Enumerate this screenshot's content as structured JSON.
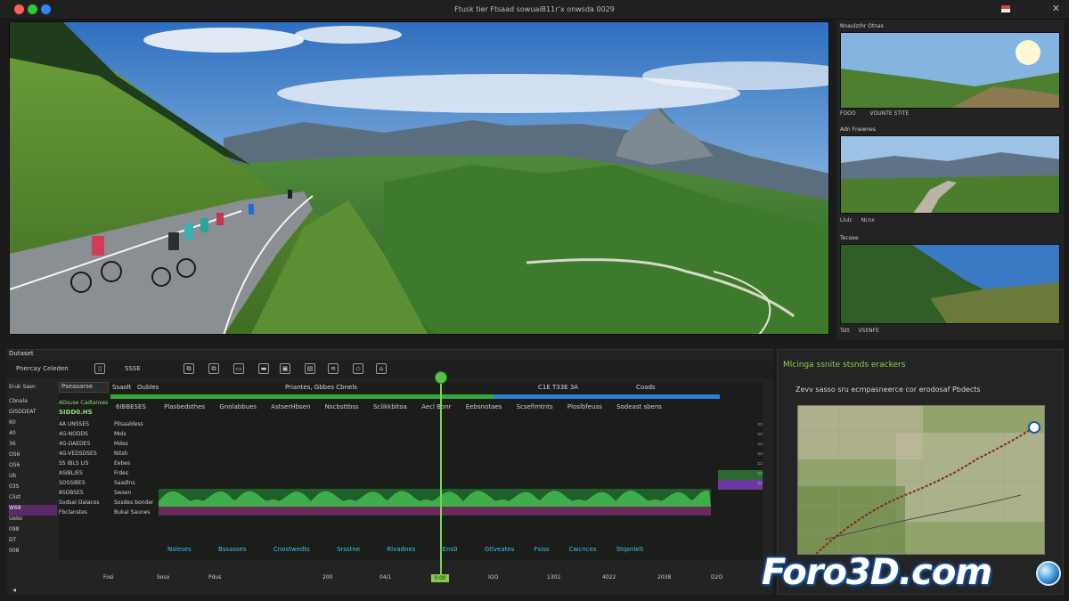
{
  "window": {
    "title": "Ftusk tier Ftsaad sowuaiB11r’x onwsda 0029"
  },
  "colors": {
    "accent_green": "#58c248",
    "clip_purple": "#7a2c7a",
    "waveform_green": "#2f8f3a",
    "header_blue": "#2f7fd6",
    "title_green": "#8fd04a"
  },
  "thumbnails": [
    {
      "header": "Nnaulzrhr Otnas",
      "footer_left": "FOOO",
      "footer_right": "VOUNTE STITE"
    },
    {
      "header": "Adn Fnewnes",
      "footer_left": "Llulc",
      "footer_right": "Ncnx"
    },
    {
      "header": "Tecoee",
      "footer_left": "Tstt",
      "footer_right": "VSENFE"
    }
  ],
  "timeline": {
    "panel_title": "Dutaset",
    "toolbar": {
      "project_label": "Pnercay Celeden",
      "tool_label": "SSSE",
      "project_icon": "page-icon"
    },
    "track_panel_title": "Eruk Sasn",
    "track_header": "Pseasarse",
    "column_headers": {
      "left": "Ssaolt",
      "left2": "Oubles",
      "center": "Priantes, Gbbes Cbnels",
      "right": "C1E T33E 3A",
      "far_right": "Coads"
    },
    "track_names": [
      "Cbnala",
      "GISDDEAT",
      "60",
      "40",
      "36",
      "OS6",
      "OS6",
      "Ub",
      "03S",
      "Clist",
      "W68",
      "Ueko",
      "098",
      "DT",
      "008"
    ],
    "track_rows": [
      {
        "a": "ADsuse Cadlanses",
        "b": "SIDD0.HS"
      },
      {
        "a": "4A UNSSES",
        "b": "Pilsaaldess"
      },
      {
        "a": "4G-NODDS",
        "b": "Mols"
      },
      {
        "a": "4G-DAEDES",
        "b": "Mdes"
      },
      {
        "a": "4G-VEDSDSES",
        "b": "Nitsh"
      },
      {
        "a": "SS IBLS LIS",
        "b": "Eebes"
      },
      {
        "a": "ASIBL/ES",
        "b": "Frdes"
      },
      {
        "a": "SOSSIBES",
        "b": "Saadlns"
      },
      {
        "a": "8SDBSES",
        "b": "Swsen"
      },
      {
        "a": "Sodsal Oalacos",
        "b": "Sosdes bonder"
      },
      {
        "a": "Fbclanstes",
        "b": "Bukal Saunes"
      }
    ],
    "clip_labels": [
      "6IBBESES",
      "Plasbedsthes",
      "Gnolabbues",
      "AstserHbsen",
      "Nscbsttbss",
      "Sclikkbitoa",
      "Aecl Bonr",
      "Eebsnotaes",
      "Scsefimtnts",
      "Ploslbfeuss",
      "Sodeast sbens"
    ],
    "bottom_labels": [
      "Nsleses",
      "Bssasses",
      "Cnostwedts",
      "Srsstne",
      "Rlvadnes",
      "Ens0",
      "Gtlveates",
      "Fsiss",
      "Cwcnces",
      "Stqsnlelt"
    ],
    "ruler": [
      "Fosi",
      "Soso",
      "Pdus",
      "200",
      "04/1",
      "IOO",
      "1302",
      "4022",
      "2038",
      "D2O"
    ],
    "playhead_time": "0:00"
  },
  "right_panel": {
    "title": "Mlcinga ssnite stsnds erackers",
    "description": "Zevv sasso sru ecmpasneerce cor erodosaf Pbdects"
  },
  "watermark": {
    "text": "Foro3D.com"
  }
}
